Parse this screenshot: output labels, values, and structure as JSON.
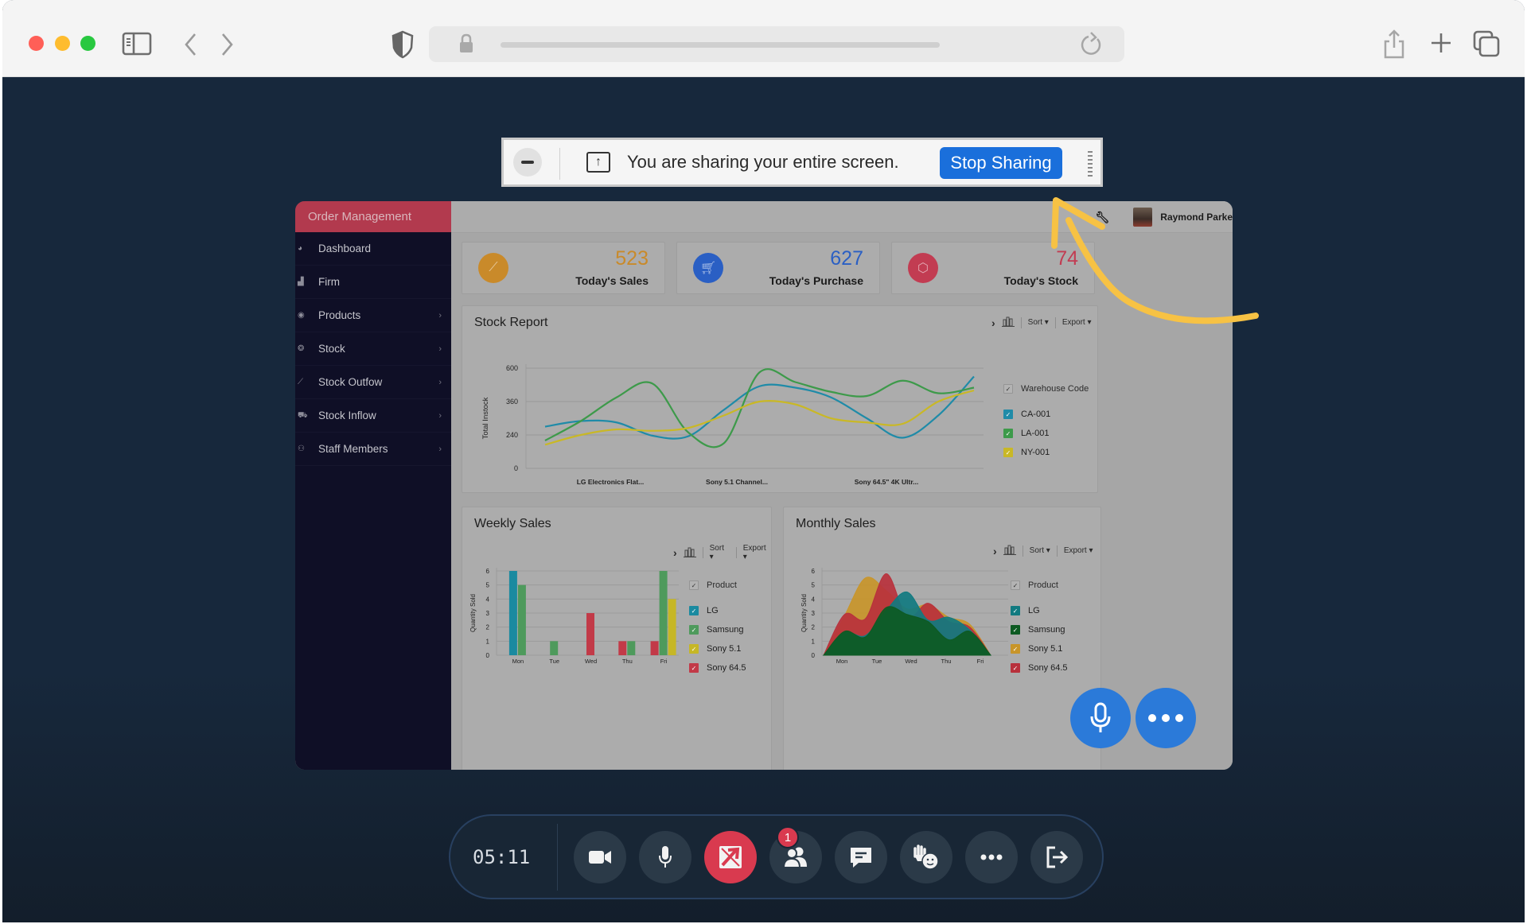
{
  "browser": {
    "traffic_lights": {
      "close": "#ff5f57",
      "minimize": "#febc2e",
      "maximize": "#28c840"
    },
    "icons": [
      "sidebar-icon",
      "back-icon",
      "forward-icon",
      "shield-icon",
      "lock-icon",
      "reload-icon",
      "share-icon",
      "new-tab-icon",
      "tabs-overview-icon"
    ]
  },
  "banner": {
    "message": "You are sharing your entire screen.",
    "stop_label": "Stop Sharing"
  },
  "dashboard": {
    "app_title": "Order Management",
    "user_name": "Raymond Parke",
    "sidebar": [
      {
        "label": "Dashboard",
        "icon": "dashboard-icon",
        "has_chevron": false
      },
      {
        "label": "Firm",
        "icon": "firm-icon",
        "has_chevron": false
      },
      {
        "label": "Products",
        "icon": "products-icon",
        "has_chevron": true
      },
      {
        "label": "Stock",
        "icon": "stock-icon",
        "has_chevron": true
      },
      {
        "label": "Stock Outfow",
        "icon": "stock-outflow-icon",
        "has_chevron": true
      },
      {
        "label": "Stock Inflow",
        "icon": "stock-inflow-icon",
        "has_chevron": true
      },
      {
        "label": "Staff Members",
        "icon": "staff-icon",
        "has_chevron": true
      }
    ],
    "stats": [
      {
        "value": "523",
        "label": "Today's Sales",
        "color": "#c98a2a",
        "icon": "chart-line-icon"
      },
      {
        "value": "627",
        "label": "Today's Purchase",
        "color": "#2a5fc4",
        "icon": "cart-icon"
      },
      {
        "value": "74",
        "label": "Today's Stock",
        "color": "#c23c52",
        "icon": "box-icon"
      }
    ],
    "tools": {
      "chevron": "›",
      "sort": "Sort ▾",
      "export": "Export ▾"
    }
  },
  "chart_data": [
    {
      "type": "line",
      "title": "Stock Report",
      "xlabel": "",
      "ylabel": "Total Instock",
      "y_ticks": [
        "0",
        "240",
        "360",
        "600"
      ],
      "categories": [
        "LG Electronics Flat...",
        "Sony 5.1 Channel...",
        "Sony 64.5\" 4K Ultr..."
      ],
      "legend_title": "Warehouse Code",
      "legend_position": "right",
      "series": [
        {
          "name": "CA-001",
          "color": "#1f8ba8",
          "values": [
            270,
            290,
            285,
            235,
            230,
            330,
            470,
            460,
            390,
            300,
            220,
            310,
            540
          ]
        },
        {
          "name": "LA-001",
          "color": "#3d9a4a",
          "values": [
            200,
            290,
            390,
            490,
            250,
            180,
            570,
            500,
            430,
            400,
            510,
            420,
            460
          ]
        },
        {
          "name": "NY-001",
          "color": "#c9b826",
          "values": [
            170,
            240,
            260,
            255,
            265,
            310,
            360,
            350,
            300,
            285,
            280,
            360,
            440
          ]
        }
      ]
    },
    {
      "type": "bar",
      "title": "Weekly Sales",
      "xlabel": "",
      "ylabel": "Quantity Sold",
      "ylim": [
        0,
        6
      ],
      "y_ticks": [
        "0",
        "1",
        "2",
        "3",
        "4",
        "5",
        "6"
      ],
      "categories": [
        "Mon",
        "Tue",
        "Wed",
        "Thu",
        "Fri"
      ],
      "legend_title": "Product",
      "legend_position": "right",
      "series": [
        {
          "name": "LG",
          "color": "#1a8aa0",
          "values": [
            6,
            0,
            0,
            0,
            0
          ]
        },
        {
          "name": "Samsung",
          "color": "#4e9a5c",
          "values": [
            5,
            1,
            0,
            1,
            6
          ]
        },
        {
          "name": "Sony 5.1",
          "color": "#c6b726",
          "values": [
            0,
            0,
            0,
            0,
            4
          ]
        },
        {
          "name": "Sony 64.5",
          "color": "#c23a48",
          "values": [
            0,
            0,
            3,
            1,
            1
          ]
        }
      ]
    },
    {
      "type": "area",
      "title": "Monthly Sales",
      "xlabel": "",
      "ylabel": "Quantity Sold",
      "ylim": [
        0,
        6
      ],
      "y_ticks": [
        "0",
        "1",
        "2",
        "3",
        "4",
        "5",
        "6"
      ],
      "categories": [
        "Mon",
        "Tue",
        "Wed",
        "Thu",
        "Fri"
      ],
      "legend_title": "Product",
      "legend_position": "right",
      "series": [
        {
          "name": "Sony 5.1",
          "color": "#c8952a",
          "values": [
            0,
            2.8,
            5.5,
            4.6,
            3.3,
            3.6,
            2.7,
            2.2,
            0
          ]
        },
        {
          "name": "Sony 64.5",
          "color": "#b8313c",
          "values": [
            0,
            2.9,
            2.6,
            5.8,
            2.7,
            3.7,
            2.4,
            2.0,
            0
          ]
        },
        {
          "name": "LG",
          "color": "#117a80",
          "values": [
            0,
            1.6,
            1.4,
            3.2,
            4.5,
            2.5,
            2.7,
            1.8,
            0
          ]
        },
        {
          "name": "Samsung",
          "color": "#0d5a22",
          "values": [
            0,
            1.7,
            1.3,
            3.4,
            2.9,
            2.4,
            1.1,
            1.7,
            0
          ]
        }
      ]
    }
  ],
  "controls": {
    "timer": "05:11",
    "participants_badge": "1",
    "buttons": [
      {
        "name": "camera-button",
        "icon": "camera-icon"
      },
      {
        "name": "mic-button",
        "icon": "mic-icon"
      },
      {
        "name": "stop-share-button",
        "icon": "screen-share-off-icon",
        "active": true
      },
      {
        "name": "participants-button",
        "icon": "participants-icon"
      },
      {
        "name": "chat-button",
        "icon": "chat-icon"
      },
      {
        "name": "reactions-button",
        "icon": "raise-hand-icon"
      },
      {
        "name": "more-button",
        "icon": "more-icon"
      },
      {
        "name": "leave-button",
        "icon": "leave-icon"
      }
    ]
  }
}
